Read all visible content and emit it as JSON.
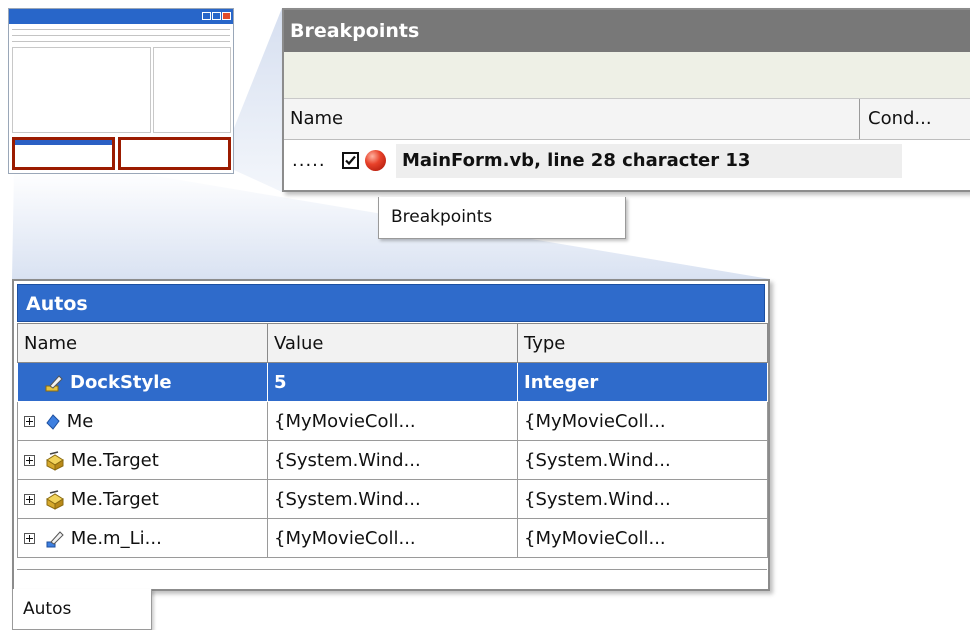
{
  "breakpoints": {
    "title": "Breakpoints",
    "columns": {
      "name": "Name",
      "condition": "Cond..."
    },
    "row": {
      "prefix": ".....",
      "checked": true,
      "text": "MainForm.vb, line 28 character 13"
    },
    "tab_label": "Breakpoints"
  },
  "autos": {
    "title": "Autos",
    "columns": [
      "Name",
      "Value",
      "Type"
    ],
    "rows": [
      {
        "name": "DockStyle",
        "value": "5",
        "type": "Integer",
        "selected": true,
        "expandable": false,
        "icon": "property-icon"
      },
      {
        "name": "Me",
        "value": "{MyMovieColl...",
        "type": "{MyMovieColl...",
        "selected": false,
        "expandable": true,
        "icon": "object-icon"
      },
      {
        "name": "Me.Target",
        "value": "{System.Wind...",
        "type": "{System.Wind...",
        "selected": false,
        "expandable": true,
        "icon": "class-icon"
      },
      {
        "name": "Me.Target",
        "value": "{System.Wind...",
        "type": "{System.Wind...",
        "selected": false,
        "expandable": true,
        "icon": "class-icon"
      },
      {
        "name": "Me.m_Li...",
        "value": "{MyMovieColl...",
        "type": "{MyMovieColl...",
        "selected": false,
        "expandable": true,
        "icon": "field-icon"
      }
    ],
    "tab_label": "Autos"
  },
  "colors": {
    "accent": "#2f6bcb",
    "breakpoint_header": "#787878",
    "highlight_border": "#9b1b00"
  }
}
